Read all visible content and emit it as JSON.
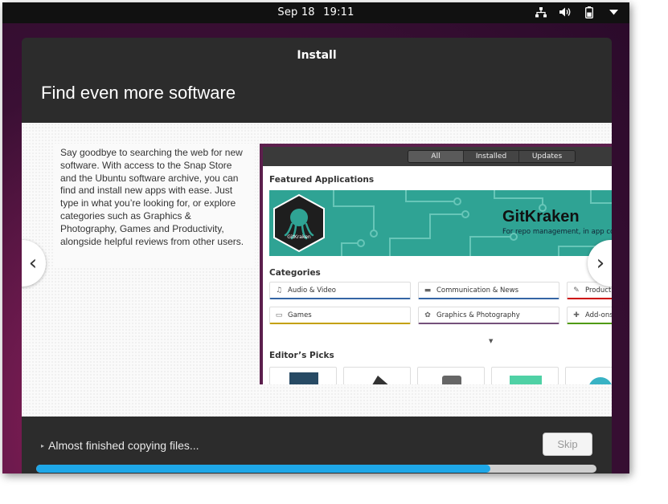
{
  "topbar": {
    "date": "Sep 18",
    "time": "19:11",
    "icons": [
      "network-icon",
      "volume-icon",
      "battery-icon",
      "system-menu-icon"
    ]
  },
  "window": {
    "title": "Install",
    "heading": "Find even more software"
  },
  "slide": {
    "description": "Say goodbye to searching the web for new software. With access to the Snap Store and the Ubuntu software archive, you can find and install new apps with ease. Just type in what you’re looking for, or explore categories such as Graphics & Photography, Games and Productivity, alongside helpful reviews from other users.",
    "prev_icon": "‹",
    "next_icon": "›",
    "store": {
      "tabs": [
        "All",
        "Installed",
        "Updates"
      ],
      "featured_title": "Featured Applications",
      "featured_app": {
        "badge_text": "GitKraken",
        "name": "GitKraken",
        "subtitle": "For repo management, in app code"
      },
      "categories_title": "Categories",
      "categories": [
        {
          "label": "Audio & Video",
          "icon": "♫",
          "color": "#3465a4"
        },
        {
          "label": "Communication & News",
          "icon": "▬",
          "color": "#3465a4"
        },
        {
          "label": "Product",
          "icon": "✎",
          "color": "#cc0000"
        },
        {
          "label": "Games",
          "icon": "▭",
          "color": "#c4a000"
        },
        {
          "label": "Graphics & Photography",
          "icon": "✿",
          "color": "#75507b"
        },
        {
          "label": "Add-ons",
          "icon": "✚",
          "color": "#4e9a06"
        }
      ],
      "more_icon": "▼",
      "editors_title": "Editor’s Picks"
    }
  },
  "footer": {
    "status": "Almost finished copying files...",
    "expander_icon": "▸",
    "skip_label": "Skip",
    "progress": 0.81,
    "progress_color": "#1ea7e8"
  }
}
